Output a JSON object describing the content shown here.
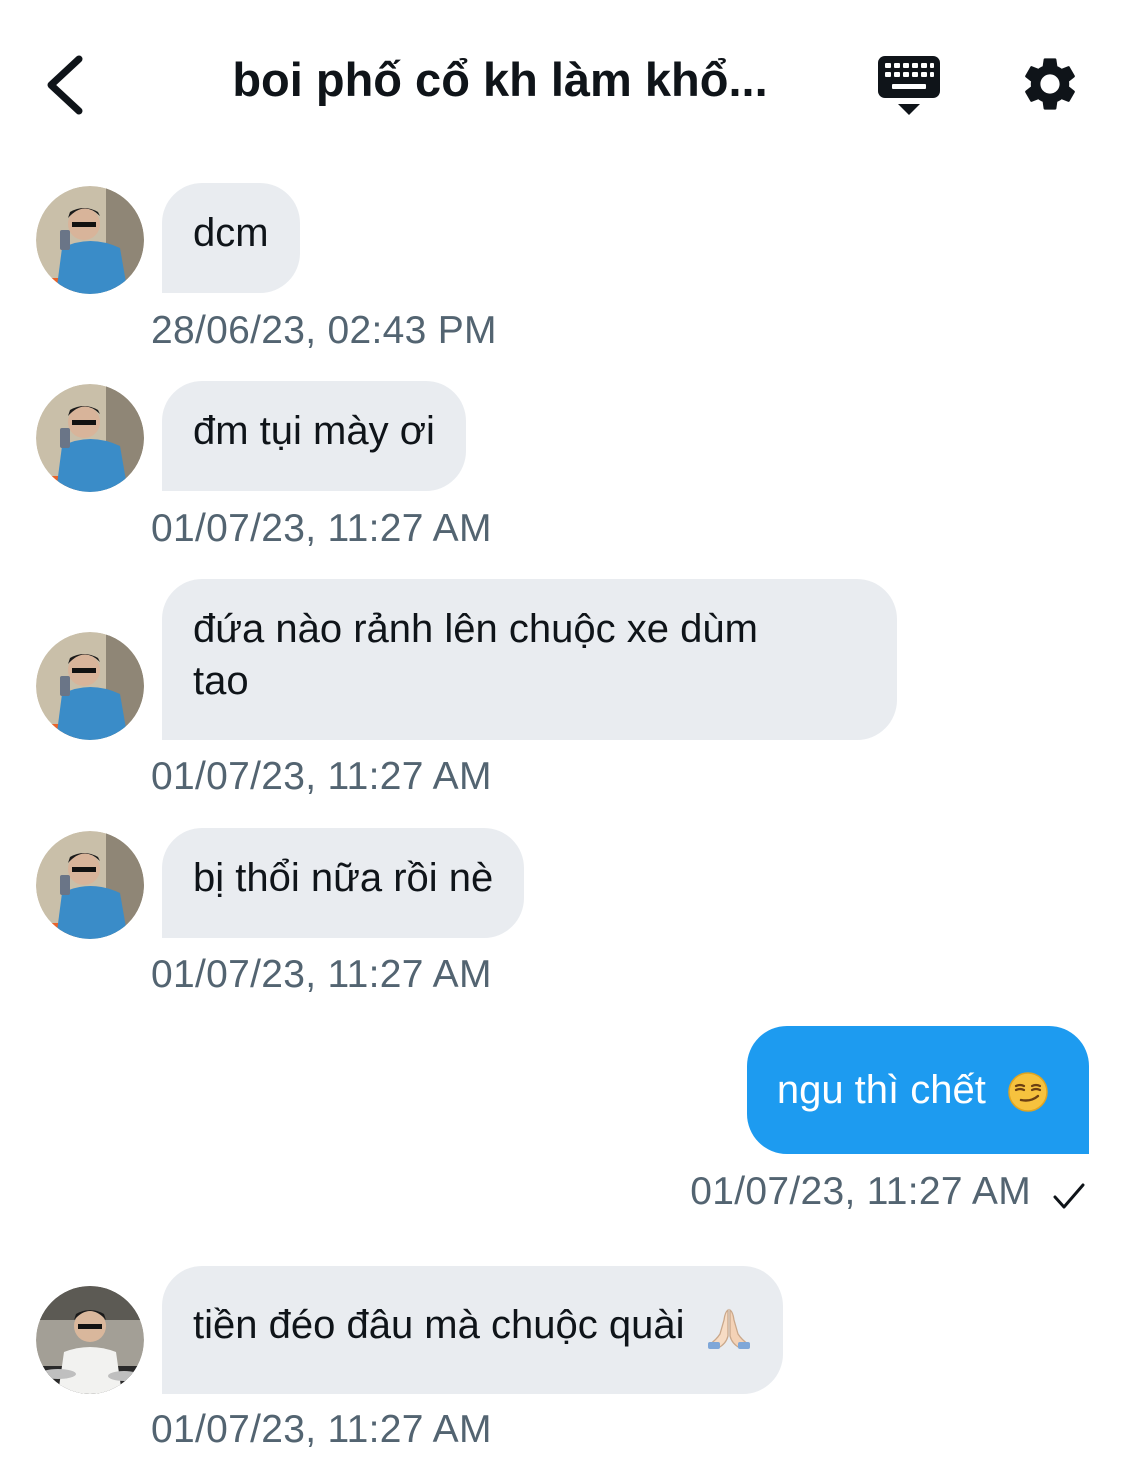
{
  "header": {
    "title": "boi phố cổ kh làm khổ..."
  },
  "messages": [
    {
      "direction": "incoming",
      "text": "dcm",
      "timestamp": "28/06/23, 02:43 PM"
    },
    {
      "direction": "incoming",
      "text": "đm tụi mày ơi",
      "timestamp": "01/07/23, 11:27 AM"
    },
    {
      "direction": "incoming",
      "text_line1": "đứa nào rảnh lên chuộc xe dùm",
      "text_line2": "tao",
      "timestamp": "01/07/23, 11:27 AM"
    },
    {
      "direction": "incoming",
      "text": "bị thổi nữa rồi nè",
      "timestamp": "01/07/23, 11:27 AM"
    },
    {
      "direction": "outgoing",
      "text": "ngu thì chết",
      "emoji": "smirking-face",
      "timestamp": "01/07/23, 11:27 AM",
      "status": "sent-check"
    },
    {
      "direction": "incoming",
      "text": "tiền đéo đâu mà chuộc quài",
      "emoji": "folded-hands",
      "timestamp": "01/07/23, 11:27 AM"
    }
  ],
  "colors": {
    "incoming_bubble": "#e9ecf0",
    "outgoing_bubble": "#1d9bf0",
    "timestamp": "#536471",
    "text": "#0f1419"
  }
}
